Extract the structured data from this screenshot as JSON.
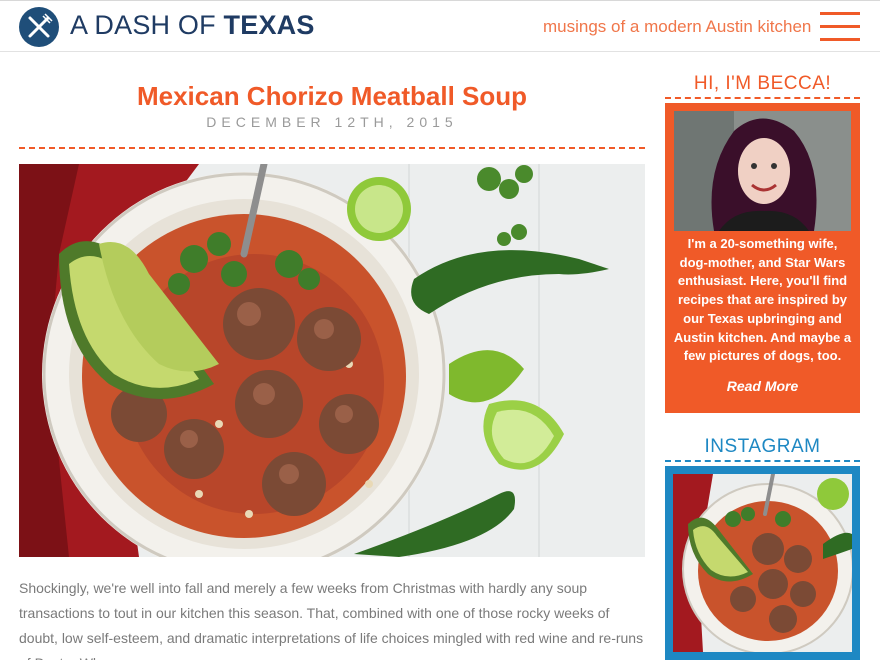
{
  "header": {
    "logo_light": "A DASH OF ",
    "logo_bold": "TEXAS",
    "tagline": "musings of a modern Austin kitchen",
    "menu_icon": "hamburger-menu-icon"
  },
  "post": {
    "title": "Mexican Chorizo Meatball Soup",
    "date": "DECEMBER 12TH, 2015",
    "hero_alt": "Bowl of Mexican chorizo meatball soup with avocado, cilantro, lime and jalapeño",
    "body": "Shockingly, we're well into fall and merely a few weeks from Christmas with hardly any soup transactions to tout in our kitchen this season. That, combined with one of those rocky weeks of doubt, low self-esteem, and dramatic interpretations of life choices mingled with red wine and re-runs of Doctor Who"
  },
  "sidebar": {
    "about_heading": "HI, I'M BECCA!",
    "about_text": "I'm a 20-something wife, dog-mother, and Star Wars enthusiast. Here, you'll find recipes that are inspired by our Texas upbringing and Austin kitchen. And maybe a few pictures of dogs, too.",
    "read_more": "Read More",
    "instagram_heading": "INSTAGRAM"
  },
  "colors": {
    "accent_orange": "#f05a28",
    "accent_blue": "#1e88c3",
    "logo_navy": "#1f3b63"
  }
}
